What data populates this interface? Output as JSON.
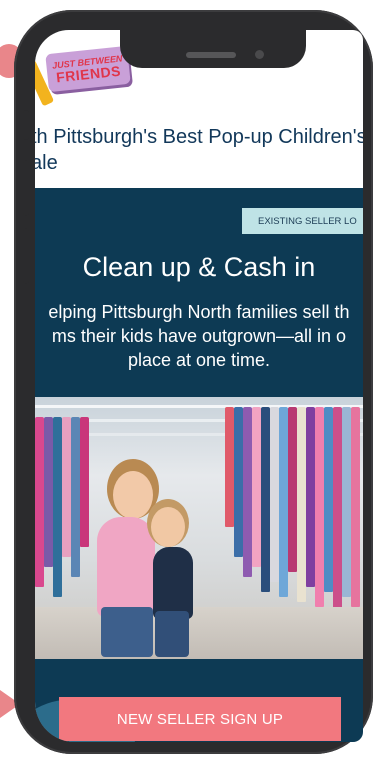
{
  "logo": {
    "line1": "JUST BETWEEN",
    "line2": "FRIENDS"
  },
  "header": {
    "tagline_line1": "th Pittsburgh's Best Pop-up Children's",
    "tagline_line2": "ale"
  },
  "hero": {
    "login_label": "EXISTING SELLER LO",
    "title": "Clean up & Cash in",
    "subtitle_line1": "elping Pittsburgh North families sell th",
    "subtitle_line2": "ms their kids have outgrown—all in o",
    "subtitle_line3": "place at one time."
  },
  "cta": {
    "signup_label": "NEW SELLER SIGN UP"
  },
  "colors": {
    "navy": "#0d3a54",
    "coral": "#f2787f",
    "light_teal": "#bfe3e6",
    "phone_frame": "#2b2b2d"
  }
}
